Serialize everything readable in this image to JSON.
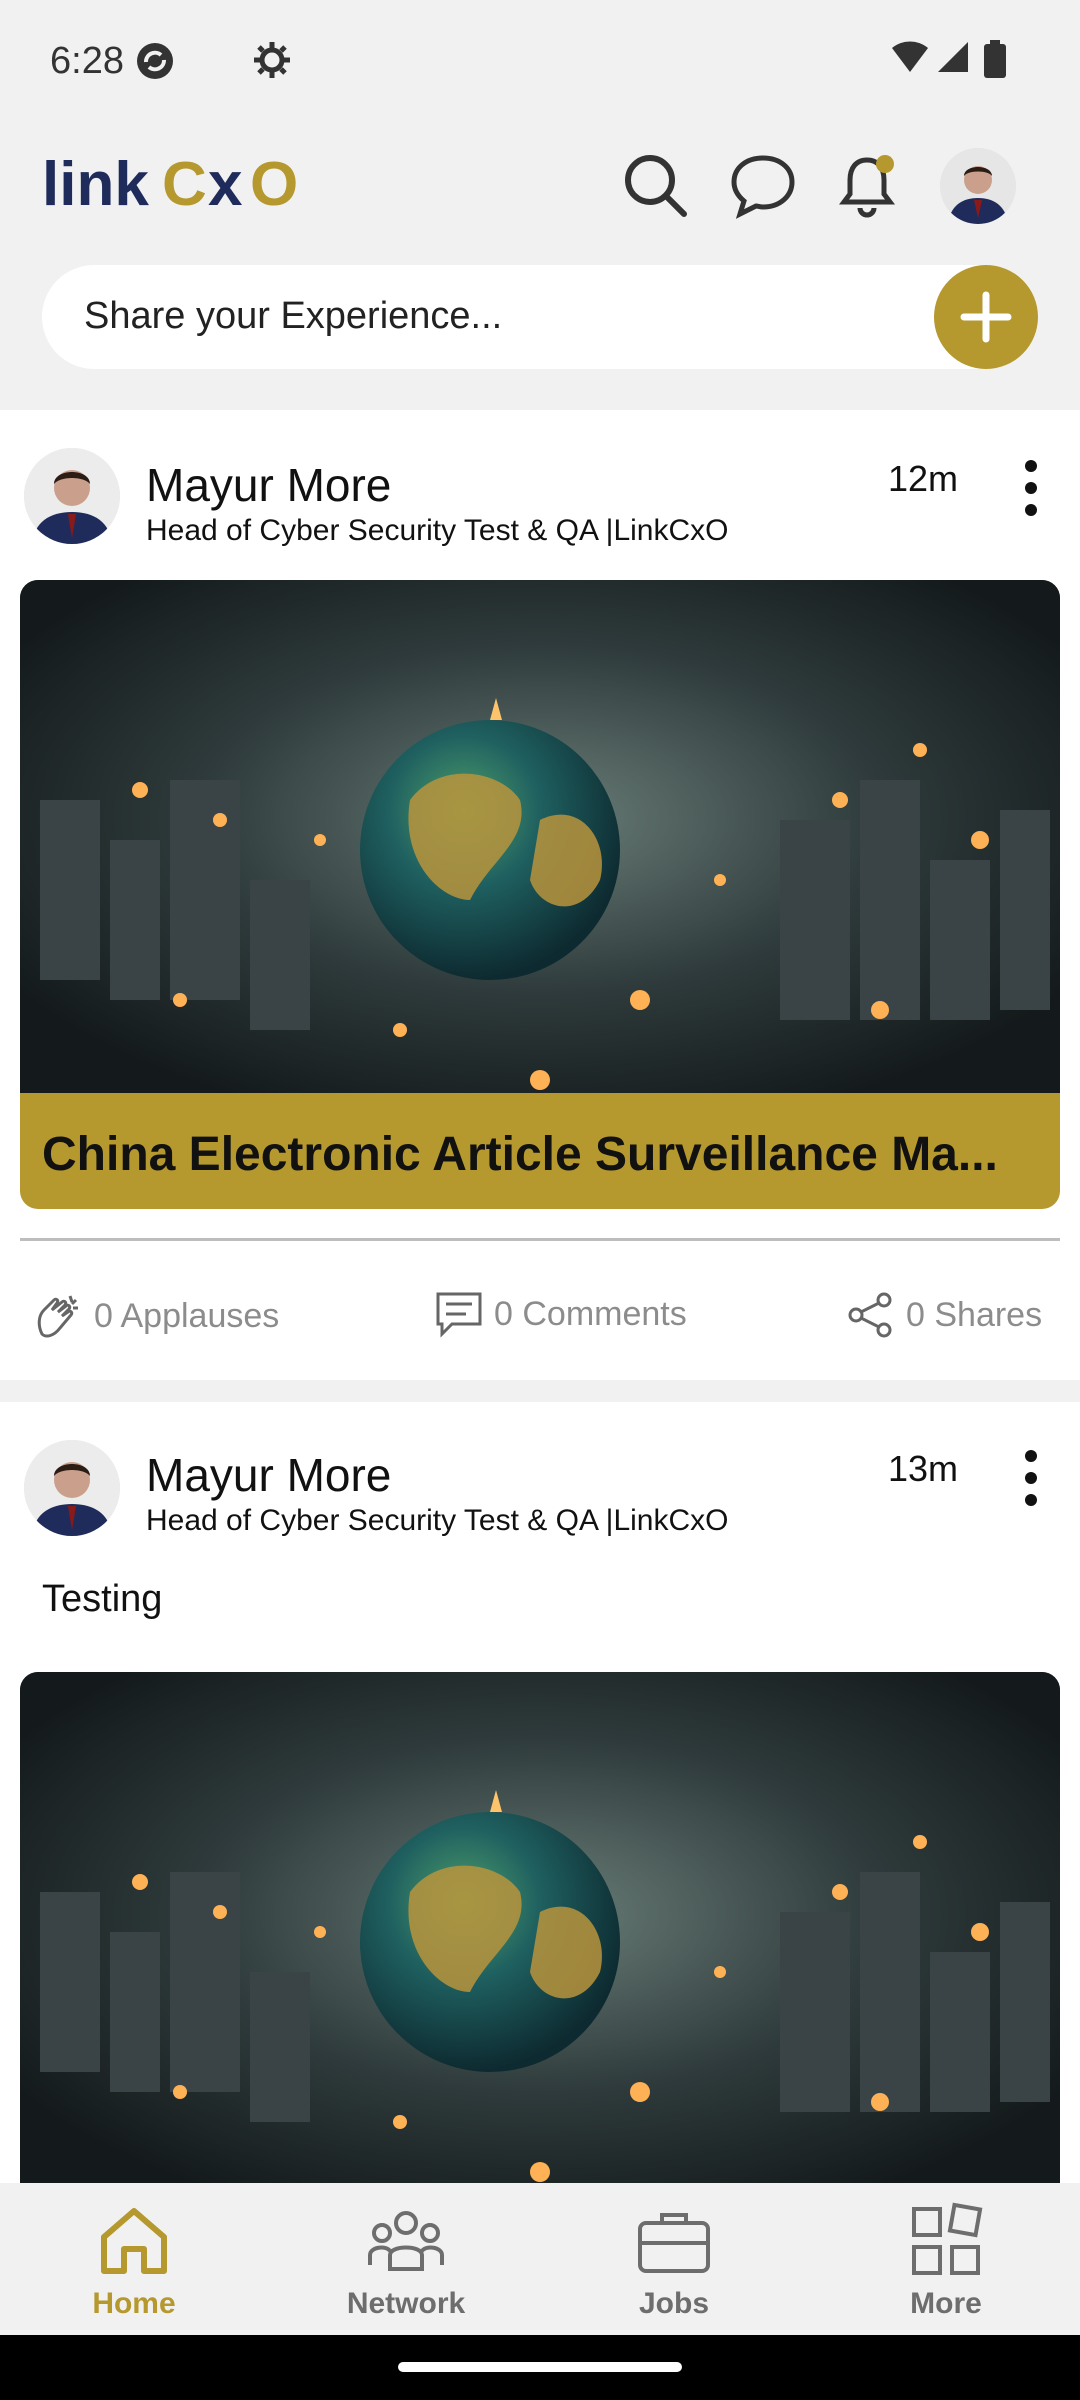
{
  "status_bar": {
    "time": "6:28"
  },
  "header": {
    "logo_text": "linkCxO",
    "icons": [
      "search-icon",
      "chat-icon",
      "notification-bell-icon",
      "profile-avatar"
    ],
    "share_placeholder": "Share your Experience..."
  },
  "posts": [
    {
      "author": "Mayur More",
      "headline": "Head of Cyber Security Test & QA |LinkCxO",
      "time": "12m",
      "caption": "China Electronic Article Surveillance Ma...",
      "applauses": "0 Applauses",
      "comments": "0 Comments",
      "shares": "0 Shares"
    },
    {
      "author": "Mayur More",
      "headline": "Head of Cyber Security Test & QA |LinkCxO",
      "time": "13m",
      "text": "Testing"
    }
  ],
  "bottom_nav": [
    {
      "label": "Home",
      "icon": "home-icon",
      "active": true
    },
    {
      "label": "Network",
      "icon": "network-icon",
      "active": false
    },
    {
      "label": "Jobs",
      "icon": "briefcase-icon",
      "active": false
    },
    {
      "label": "More",
      "icon": "grid-icon",
      "active": false
    }
  ],
  "colors": {
    "accent": "#b5982e",
    "background": "#f1f1f1"
  }
}
